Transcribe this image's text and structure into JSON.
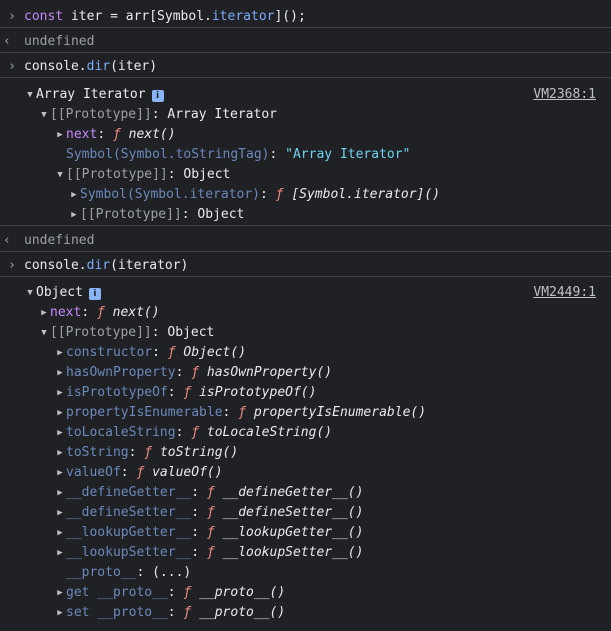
{
  "colors": {
    "background": "#202124",
    "keyword": "#c58af9",
    "property": "#7baaf7",
    "string": "#6dd3ee",
    "function_marker": "#f28b82",
    "muted": "#9aa0a6",
    "text": "#e8eaed"
  },
  "icons": {
    "prompt": "chevron-right-icon",
    "return": "return-arrow-icon",
    "expand": "triangle-right-icon",
    "collapse": "triangle-down-icon",
    "info": "info-icon"
  },
  "entries": {
    "input1": {
      "prompt": "›",
      "kw": "const",
      "rest1": " iter = arr[Symbol.",
      "method": "iterator",
      "rest2": "]();"
    },
    "return1": {
      "arrow": "‹",
      "value": "undefined"
    },
    "input2": {
      "prompt": "›",
      "obj": "console.",
      "method": "dir",
      "args": "(iter)"
    },
    "output2": {
      "header": "Array Iterator",
      "info": "i",
      "source": "VM2368:1",
      "proto1_key": "[[Prototype]]",
      "proto1_val": "Array Iterator",
      "next_key": "next",
      "next_fmark": "ƒ",
      "next_val": "next()",
      "tag_key": "Symbol(Symbol.toStringTag)",
      "tag_val": "\"Array Iterator\"",
      "proto2_key": "[[Prototype]]",
      "proto2_val": "Object",
      "symiter_key": "Symbol(Symbol.iterator)",
      "symiter_fmark": "ƒ",
      "symiter_val": "[Symbol.iterator]()",
      "proto3_key": "[[Prototype]]",
      "proto3_val": "Object"
    },
    "return2": {
      "arrow": "‹",
      "value": "undefined"
    },
    "input3": {
      "prompt": "›",
      "obj": "console.",
      "method": "dir",
      "args": "(iterator)"
    },
    "output3": {
      "header": "Object",
      "info": "i",
      "source": "VM2449:1",
      "next_key": "next",
      "next_fmark": "ƒ",
      "next_val": "next()",
      "proto_key": "[[Prototype]]",
      "proto_val": "Object",
      "members": [
        {
          "key": "constructor",
          "fmark": "ƒ",
          "val": "Object()"
        },
        {
          "key": "hasOwnProperty",
          "fmark": "ƒ",
          "val": "hasOwnProperty()"
        },
        {
          "key": "isPrototypeOf",
          "fmark": "ƒ",
          "val": "isPrototypeOf()"
        },
        {
          "key": "propertyIsEnumerable",
          "fmark": "ƒ",
          "val": "propertyIsEnumerable()"
        },
        {
          "key": "toLocaleString",
          "fmark": "ƒ",
          "val": "toLocaleString()"
        },
        {
          "key": "toString",
          "fmark": "ƒ",
          "val": "toString()"
        },
        {
          "key": "valueOf",
          "fmark": "ƒ",
          "val": "valueOf()"
        },
        {
          "key": "__defineGetter__",
          "fmark": "ƒ",
          "val": "__defineGetter__()"
        },
        {
          "key": "__defineSetter__",
          "fmark": "ƒ",
          "val": "__defineSetter__()"
        },
        {
          "key": "__lookupGetter__",
          "fmark": "ƒ",
          "val": "__lookupGetter__()"
        },
        {
          "key": "__lookupSetter__",
          "fmark": "ƒ",
          "val": "__lookupSetter__()"
        }
      ],
      "proto_accessor_key": "__proto__",
      "proto_accessor_val": "(...)",
      "getter_label": "get __proto__",
      "getter_fmark": "ƒ",
      "getter_val": "__proto__()",
      "setter_label": "set __proto__",
      "setter_fmark": "ƒ",
      "setter_val": "__proto__()"
    }
  }
}
